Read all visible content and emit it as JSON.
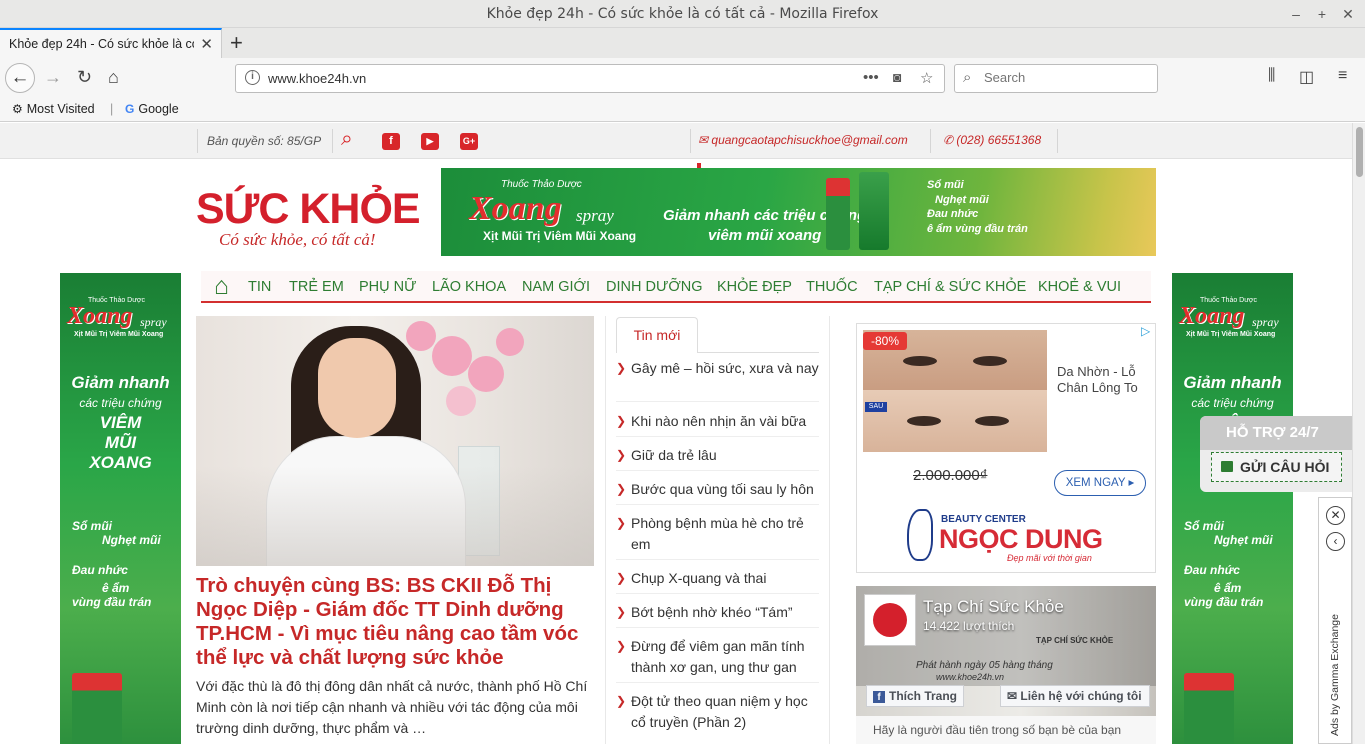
{
  "window": {
    "title": "Khỏe đẹp 24h - Có sức khỏe là có tất cả - Mozilla Firefox",
    "minimize": "‒",
    "maximize": "+",
    "close": "✕"
  },
  "tab": {
    "title": "Khỏe đẹp 24h - Có sức khỏe là có",
    "close": "✕",
    "new_tab": "+"
  },
  "toolbar": {
    "url": "www.khoe24h.vn",
    "search_placeholder": "Search"
  },
  "bookmarks": [
    {
      "label": "Most Visited",
      "icon": "gear-icon"
    },
    {
      "label": "Google",
      "icon": "google-icon"
    }
  ],
  "topbar": {
    "copyright": "Bản quyền số: 85/GP",
    "email": "quangcaotapchisuckhoe@gmail.com",
    "phone": "(028) 66551368",
    "social": [
      "facebook",
      "youtube",
      "google-plus"
    ]
  },
  "logo": {
    "brand": "SỨC KHỎE",
    "slogan": "Có sức khỏe, có tất cả!"
  },
  "banner": {
    "subtitle": "Thuốc Thảo Dược",
    "product": "Xoang",
    "product_suffix": "spray",
    "line": "Xịt Mũi Trị Viêm Mũi Xoang",
    "claim_1": "Giảm nhanh các triệu chứng",
    "claim_2": "viêm mũi xoang",
    "symptoms": [
      "Sổ mũi",
      "Nghẹt mũi",
      "Đau nhức",
      "ê ẩm vùng đầu trán"
    ]
  },
  "side_ad": {
    "subtitle": "Thuốc Thảo Dược",
    "product": "Xoang",
    "product_suffix": "spray",
    "line": "Xịt Mũi Trị Viêm Mũi Xoang",
    "claim_top": "Giảm nhanh",
    "claim_mid": "các triệu chứng",
    "claim_b1": "VIÊM",
    "claim_b2": "MŨI",
    "claim_b3": "XOANG",
    "symptoms": [
      "Sổ mũi",
      "Nghẹt mũi",
      "Đau nhức",
      "ê ẩm",
      "vùng đầu trán"
    ]
  },
  "menu": [
    "TIN",
    "TRẺ EM",
    "PHỤ NỮ",
    "LÃO KHOA",
    "NAM GIỚI",
    "DINH DƯỠNG",
    "KHỎE ĐẸP",
    "THUỐC",
    "TẠP CHÍ & SỨC KHỎE",
    "KHOẺ & VUI"
  ],
  "article": {
    "headline": "Trò chuyện cùng BS: BS CKII Đỗ Thị Ngọc Diệp - Giám đốc TT Dinh dưỡng TP.HCM - Vì mục tiêu nâng cao tầm vóc thể lực và chất lượng sức khỏe",
    "excerpt": "Với đặc thù là đô thị đông dân nhất cả nước, thành phố Hồ Chí Minh còn là nơi tiếp cận nhanh và nhiều với tác động của môi trường dinh dưỡng, thực phẩm và …"
  },
  "latest": {
    "tab_label": "Tin mới",
    "items": [
      "Gây mê – hồi sức, xưa và nay",
      "Khi nào nên nhịn ăn vài bữa",
      "Giữ da trẻ lâu",
      "Bước qua vùng tối sau ly hôn",
      "Phòng bệnh mùa hè cho trẻ em",
      "Chụp X-quang và thai",
      "Bớt bệnh nhờ khéo “Tám”",
      "Đừng để viêm gan mãn tính thành xơ gan, ung thư gan",
      "Đột tử theo quan niệm y học cổ truyền (Phần 2)"
    ]
  },
  "ad": {
    "discount": "-80%",
    "after_label": "SAU",
    "title": "Da Nhờn - Lỗ Chân Lông To",
    "old_price": "2.000.000₫",
    "cta": "XEM NGAY ▸",
    "brand_small": "BEAUTY CENTER",
    "brand_big": "NGỌC DUNG",
    "brand_tag": "Đẹp mãi với thời gian"
  },
  "facebook": {
    "page_name": "Tạp Chí Sức Khỏe",
    "likes": "14.422 lượt thích",
    "cover_line1": "TẠP CHÍ SỨC KHỎE",
    "cover_line2": "Phát hành ngày 05 hàng tháng",
    "cover_line3": "www.khoe24h.vn",
    "like_button": "Thích Trang",
    "contact_button": "Liên hệ với chúng tôi",
    "note": "Hãy là người đầu tiên trong số bạn bè của bạn"
  },
  "support": {
    "title": "HỖ TRỢ 24/7",
    "button": "GỬI CÂU HỎI"
  },
  "gamma": {
    "label": "Ads by Gamma Exchange",
    "close": "✕",
    "collapse": "‹"
  },
  "colors": {
    "brand_red": "#d4202c",
    "menu_green": "#2e7d32",
    "banner_green": "#2aa645"
  }
}
